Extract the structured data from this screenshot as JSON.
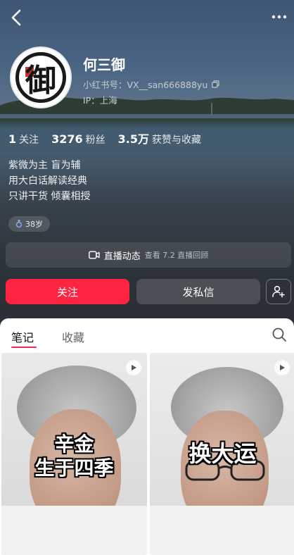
{
  "profile": {
    "name": "何三御",
    "id_text": "小红书号：VX__san666888yu",
    "ip_text": "IP：上海",
    "avatar_glyph": "御"
  },
  "stats": [
    {
      "num": "1",
      "label": "关注"
    },
    {
      "num": "3276",
      "label": "粉丝"
    },
    {
      "num": "3.5万",
      "label": "获赞与收藏"
    }
  ],
  "bio": [
    "紫微为主 盲为辅",
    "用大白话解读经典",
    "只讲干货 倾囊相授"
  ],
  "age_tag": "38岁",
  "live": {
    "label": "直播动态",
    "sub": "查看 7.2 直播回顾"
  },
  "actions": {
    "follow": "关注",
    "message": "发私信"
  },
  "tabs": [
    {
      "label": "笔记",
      "active": true
    },
    {
      "label": "收藏",
      "active": false
    }
  ],
  "posts": [
    {
      "overlay_lines": [
        "辛金",
        "生于四季"
      ],
      "type": "video"
    },
    {
      "overlay_lines": [
        "换大运"
      ],
      "type": "video"
    }
  ],
  "colors": {
    "accent": "#ff2442"
  },
  "icons": [
    "back-icon",
    "more-icon",
    "copy-icon",
    "gender-icon",
    "video-icon",
    "add-friend-icon",
    "search-icon",
    "play-icon"
  ]
}
